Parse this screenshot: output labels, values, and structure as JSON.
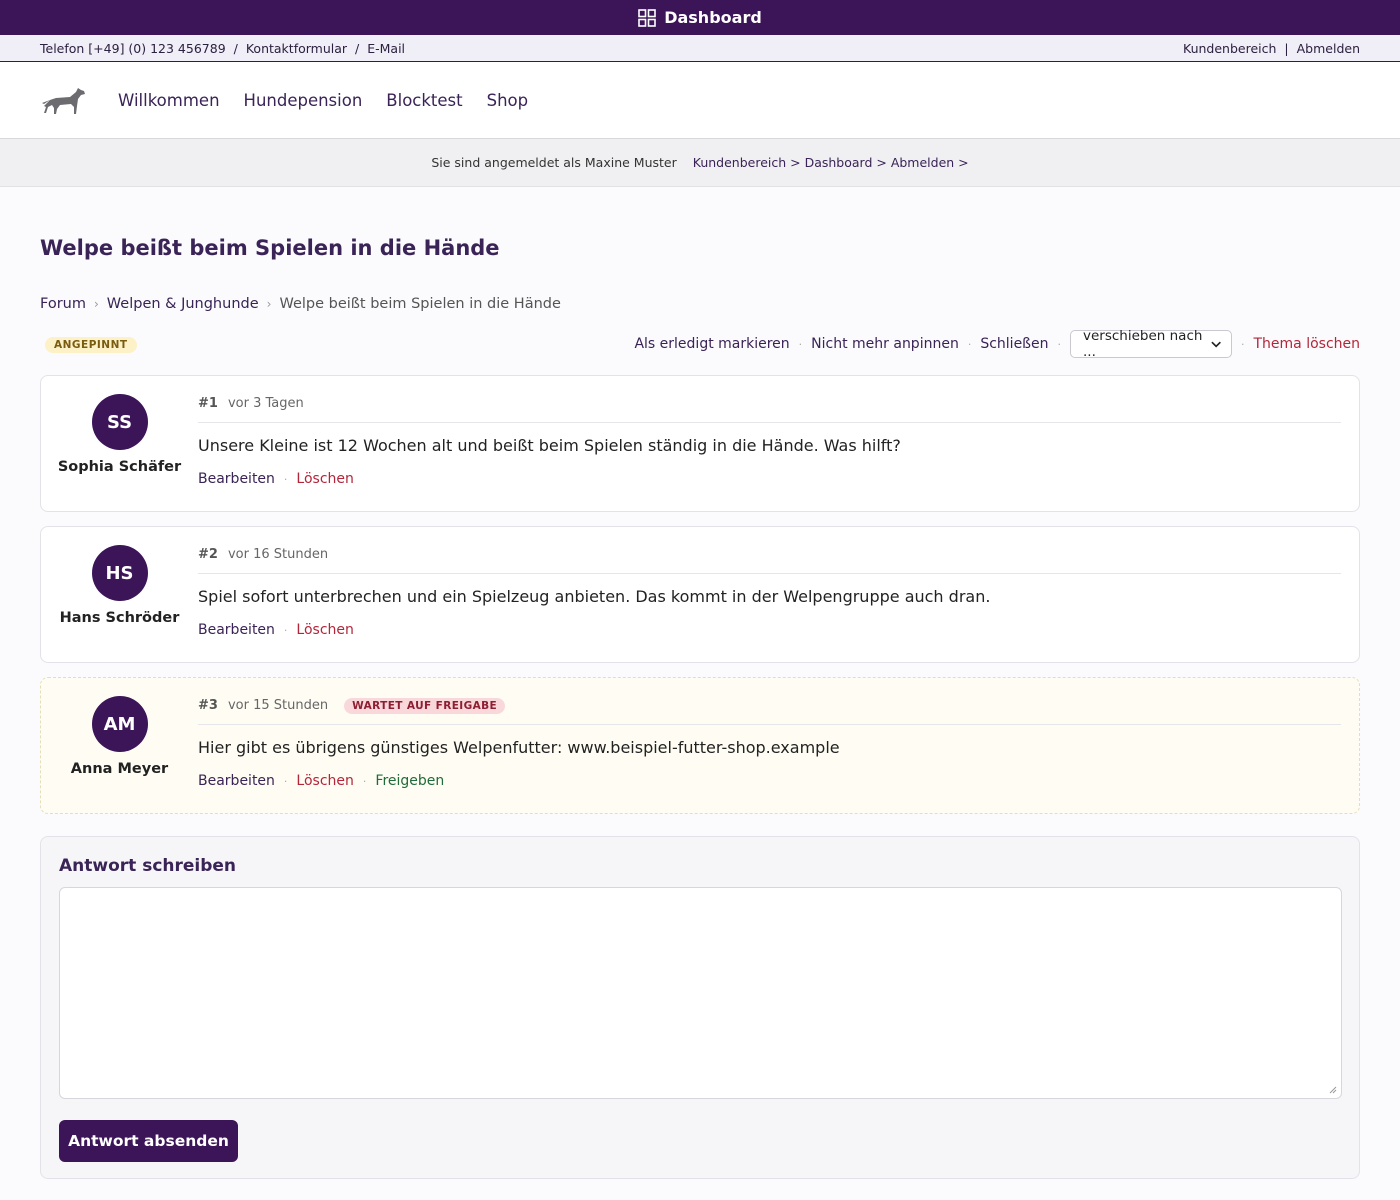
{
  "dashbar": {
    "icon": "grid-icon",
    "label": "Dashboard"
  },
  "contact": {
    "phone": "Telefon [+49] (0) 123 456789",
    "sep": "/",
    "form": "Kontaktformular",
    "email": "E-Mail",
    "customer_area": "Kundenbereich",
    "pipe": "|",
    "logout": "Abmelden"
  },
  "nav": {
    "logo_icon": "dog-icon",
    "items": [
      "Willkommen",
      "Hundepension",
      "Blocktest",
      "Shop"
    ]
  },
  "login": {
    "status": "Sie sind angemeldet als Maxine Muster",
    "crumbs": "Kundenbereich > Dashboard > Abmelden >"
  },
  "thread": {
    "title": "Welpe beißt beim Spielen in die Hände",
    "breadcrumb": [
      "Forum",
      "Welpen & Junghunde",
      "Welpe beißt beim Spielen in die Hände"
    ],
    "pinned_badge": "ANGEPINNT",
    "actions": {
      "mark_done": "Als erledigt markieren",
      "unpin": "Nicht mehr anpinnen",
      "close": "Schließen",
      "move_select": "verschieben nach ...",
      "delete": "Thema löschen"
    }
  },
  "posts": [
    {
      "initials": "SS",
      "author": "Sophia Schäfer",
      "num": "#1",
      "time": "vor 3 Tagen",
      "text": "Unsere Kleine ist 12 Wochen alt und beißt beim Spielen ständig in die Hände. Was hilft?",
      "edit": "Bearbeiten",
      "delete": "Löschen"
    },
    {
      "initials": "HS",
      "author": "Hans Schröder",
      "num": "#2",
      "time": "vor 16 Stunden",
      "text": "Spiel sofort unterbrechen und ein Spielzeug anbieten. Das kommt in der Welpengruppe auch dran.",
      "edit": "Bearbeiten",
      "delete": "Löschen"
    },
    {
      "initials": "AM",
      "author": "Anna Meyer",
      "num": "#3",
      "time": "vor 15 Stunden",
      "badge": "WARTET AUF FREIGABE",
      "text": "Hier gibt es übrigens günstiges Welpenfutter: www.beispiel-futter-shop.example",
      "edit": "Bearbeiten",
      "delete": "Löschen",
      "approve": "Freigeben"
    }
  ],
  "reply": {
    "title": "Antwort schreiben",
    "textarea_value": "",
    "submit": "Antwort absenden"
  },
  "colors": {
    "brand": "#3c1458",
    "danger": "#b3263a",
    "success": "#1f6b3a",
    "pinned_bg": "#fdf1c8",
    "pending_bg": "#fffdf3"
  }
}
